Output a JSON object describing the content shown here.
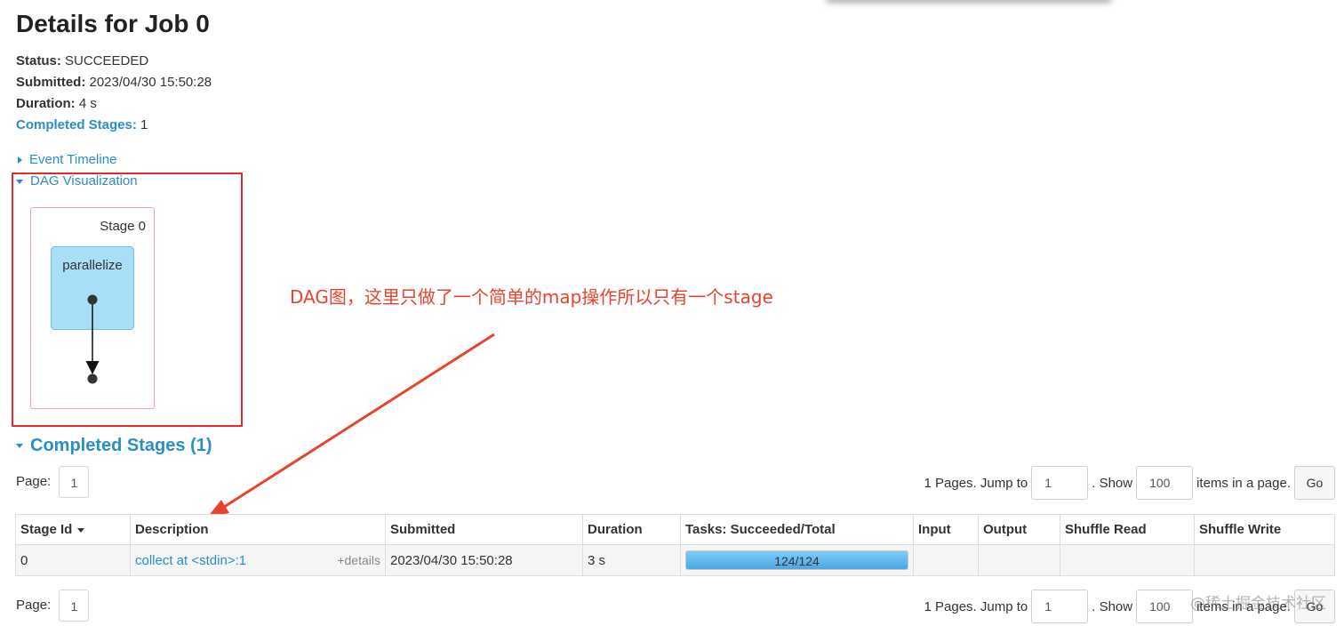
{
  "page": {
    "title": "Details for Job 0"
  },
  "summary": {
    "status_label": "Status:",
    "status_value": "SUCCEEDED",
    "submitted_label": "Submitted:",
    "submitted_value": "2023/04/30 15:50:28",
    "duration_label": "Duration:",
    "duration_value": "4 s",
    "completed_label": "Completed Stages:",
    "completed_value": "1"
  },
  "expanders": {
    "event_timeline": "Event Timeline",
    "dag_visualization": "DAG Visualization"
  },
  "dag": {
    "stage_label": "Stage 0",
    "rdd_label": "parallelize"
  },
  "annotation": {
    "text": "DAG图，这里只做了一个简单的map操作所以只有一个stage",
    "color": "#e8432e"
  },
  "section": {
    "title": "Completed Stages (1)"
  },
  "pagination": {
    "page_label": "Page:",
    "current_page": "1",
    "pages_text": "1 Pages. Jump to",
    "jump_value": "1",
    "show_text": ". Show",
    "show_value": "100",
    "items_text": "items in a page.",
    "go_label": "Go"
  },
  "table": {
    "headers": {
      "stage_id": "Stage Id",
      "description": "Description",
      "submitted": "Submitted",
      "duration": "Duration",
      "tasks": "Tasks: Succeeded/Total",
      "input": "Input",
      "output": "Output",
      "shuffle_read": "Shuffle Read",
      "shuffle_write": "Shuffle Write"
    },
    "rows": [
      {
        "stage_id": "0",
        "description": "collect at <stdin>:1",
        "details": "+details",
        "submitted": "2023/04/30 15:50:28",
        "duration": "3 s",
        "tasks_text": "124/124",
        "tasks_fraction": 1.0,
        "input": "",
        "output": "",
        "shuffle_read": "",
        "shuffle_write": ""
      }
    ]
  },
  "watermark": {
    "text": "@稀土掘金技术社区"
  },
  "colors": {
    "link": "#2a8fc6",
    "annotation_box": "#e32b2b",
    "rdd_fill": "#a8def7",
    "stage_border": "#f2a0b4"
  }
}
